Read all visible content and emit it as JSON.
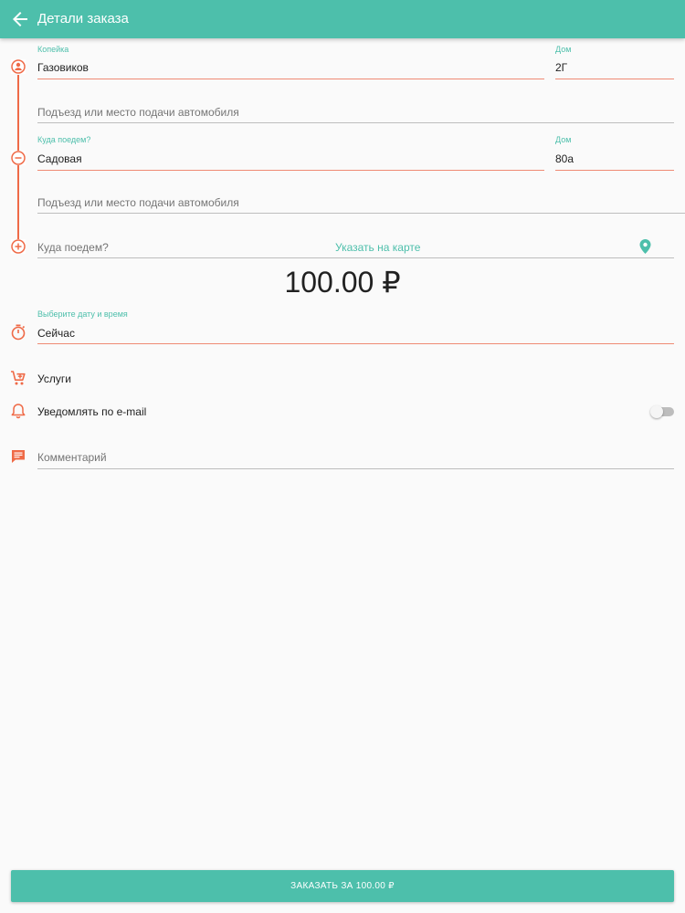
{
  "header": {
    "title": "Детали заказа",
    "back_icon": "arrow-left-icon"
  },
  "colors": {
    "primary": "#4dbfab",
    "accent": "#ef6a47",
    "divider": "#bdbdbd"
  },
  "route": {
    "from": {
      "street_label": "Копейка",
      "street_value": "Газовиков",
      "house_label": "Дом",
      "house_value": "2Г",
      "entrance_placeholder": "Подъезд или место подачи автомобиля"
    },
    "to": {
      "street_label": "Куда поедем?",
      "street_value": "Садовая",
      "house_label": "Дом",
      "house_value": "80а",
      "entrance_placeholder": "Подъезд или место подачи автомобиля"
    },
    "add": {
      "placeholder": "Куда поедем?",
      "map_link": "Указать на карте"
    }
  },
  "price": "100.00 ₽",
  "datetime": {
    "label": "Выберите дату и время",
    "value": "Сейчас"
  },
  "services": {
    "label": "Услуги"
  },
  "email_notify": {
    "label": "Уведомлять по e-mail",
    "enabled": false
  },
  "comment": {
    "placeholder": "Комментарий"
  },
  "order_button": {
    "label": "ЗАКАЗАТЬ ЗА 100.00 ₽"
  }
}
